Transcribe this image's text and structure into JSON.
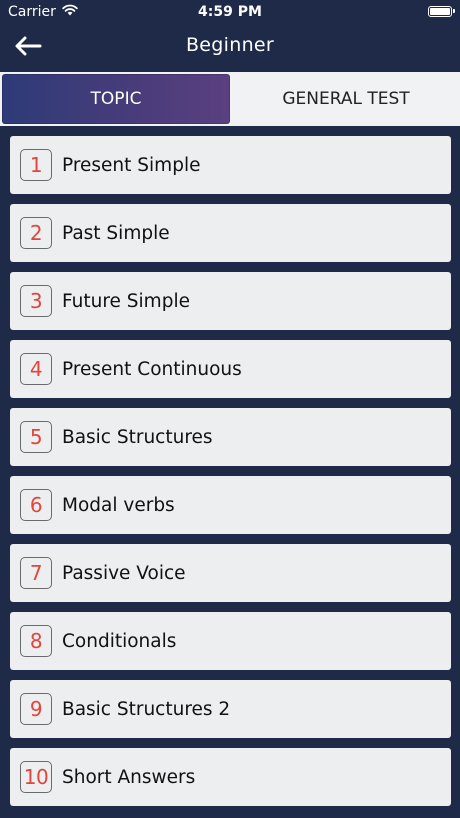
{
  "status_bar": {
    "carrier": "Carrier",
    "time": "4:59 PM",
    "wifi_icon": "wifi-icon",
    "battery_icon": "battery-icon"
  },
  "nav": {
    "title": "Beginner",
    "back_icon": "arrow-left-icon"
  },
  "tabs": [
    {
      "label": "TOPIC",
      "active": true
    },
    {
      "label": "GENERAL TEST",
      "active": false
    }
  ],
  "topics": [
    {
      "number": "1",
      "label": "Present Simple"
    },
    {
      "number": "2",
      "label": "Past Simple"
    },
    {
      "number": "3",
      "label": "Future Simple"
    },
    {
      "number": "4",
      "label": "Present Continuous"
    },
    {
      "number": "5",
      "label": "Basic Structures"
    },
    {
      "number": "6",
      "label": "Modal verbs"
    },
    {
      "number": "7",
      "label": "Passive Voice"
    },
    {
      "number": "8",
      "label": "Conditionals"
    },
    {
      "number": "9",
      "label": "Basic Structures 2"
    },
    {
      "number": "10",
      "label": "Short Answers"
    }
  ],
  "colors": {
    "background": "#1e2a47",
    "item_background": "#eceeef",
    "number_color": "#e2453c",
    "active_tab_start": "#2d3b78",
    "active_tab_end": "#5a4081"
  }
}
